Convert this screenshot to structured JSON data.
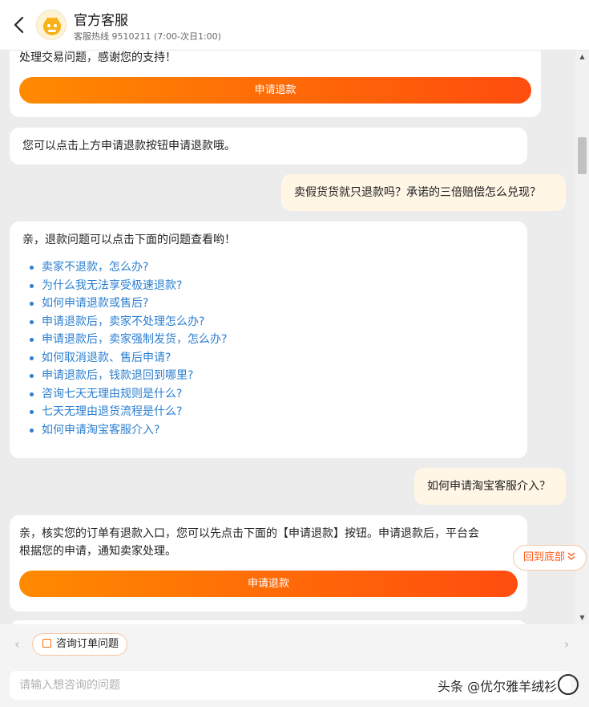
{
  "header": {
    "title": "官方客服",
    "subtitle": "客服热线 9510211 (7:00-次日1:00)"
  },
  "messages": {
    "card1_text": "处理交易问题，感谢您的支持！",
    "card1_button": "申请退款",
    "card2_text": "您可以点击上方申请退款按钮申请退款哦。",
    "user1": "卖假货货就只退款吗？承诺的三倍赔偿怎么兑现？",
    "card3_intro": "亲，退款问题可以点击下面的问题查看哟！",
    "faq": [
      "卖家不退款，怎么办?",
      "为什么我无法享受极速退款?",
      "如何申请退款或售后?",
      "申请退款后，卖家不处理怎么办?",
      "申请退款后，卖家强制发货，怎么办?",
      "如何取消退款、售后申请?",
      "申请退款后，钱款退回到哪里?",
      "咨询七天无理由规则是什么?",
      "七天无理由退货流程是什么?",
      "如何申请淘宝客服介入?"
    ],
    "user2": "如何申请淘宝客服介入？",
    "card4_line1": "亲，核实您的订单有退款入口，您可以先点击下面的【申请退款】按钮。申请退款后，平台会",
    "card4_line2": "根据您的申请，通知卖家处理。",
    "card4_button": "申请退款"
  },
  "back_to_bottom": "回到底部",
  "footer": {
    "chip_label": "咨询订单问题",
    "input_placeholder": "请输入想咨询的问题",
    "watermark": "头条 @优尔雅羊绒衫"
  },
  "colors": {
    "accent_start": "#ff8a00",
    "accent_end": "#ff4d0e",
    "link": "#2b7fd0",
    "user_bubble": "#fff6e6"
  },
  "icons": [
    "back-arrow-icon",
    "bot-avatar-icon",
    "shopping-bag-icon",
    "chevron-left-icon",
    "chevron-right-icon",
    "double-chevron-down-icon"
  ]
}
